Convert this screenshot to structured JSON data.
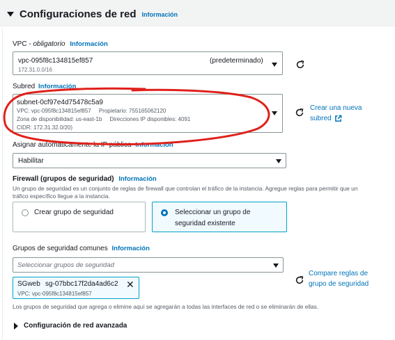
{
  "section": {
    "title": "Configuraciones de red",
    "info": "Información"
  },
  "vpc": {
    "label_main": "VPC - ",
    "label_req": "obligatorio",
    "info": "Información",
    "value": "vpc-095f8c134815ef857",
    "tag": "(predeterminado)",
    "cidr": "172.31.0.0/16"
  },
  "subnet": {
    "label": "Subred",
    "info": "Información",
    "value": "subnet-0cf97e4d75478c5a9",
    "line1": "VPC: vpc-095f8c134815ef857     Propietario: 755165062120",
    "line2": "Zona de disponibilidad: us-east-1b     Direcciones IP disponibles: 4091",
    "line3": "CIDR: 172.31.32.0/20)",
    "create_link_1": "Crear una nueva",
    "create_link_2": "subred"
  },
  "public_ip": {
    "label": "Asignar automáticamente la IP pública",
    "info": "Información",
    "value": "Habilitar"
  },
  "firewall": {
    "label": "Firewall (grupos de seguridad)",
    "info": "Información",
    "desc1": "Un grupo de seguridad es un conjunto de reglas de firewall que controlan el tráfico de la instancia. Agregue reglas para permitir que un",
    "desc2": "tráfico específico llegue a la instancia.",
    "option_create": "Crear grupo de seguridad",
    "option_select_1": "Seleccionar un grupo de",
    "option_select_2": "seguridad existente"
  },
  "common_groups": {
    "label": "Grupos de seguridad comunes",
    "info": "Información",
    "placeholder": "Seleccionar grupos de seguridad",
    "token_name": "SGweb",
    "token_id": "sg-07bbc17f2da4ad6c2",
    "token_vpc": "VPC: vpc-095f8c134815ef857",
    "compare_1": "Compare reglas de",
    "compare_2": "grupo de seguridad",
    "note": "Los grupos de seguridad que agrega o elimine aquí se agregarán a todas las interfaces de red o se eliminarán de ellas."
  },
  "advanced": {
    "label": "Configuración de red avanzada"
  },
  "colors": {
    "link": "#0073bb",
    "selected_border": "#00a1c9",
    "annotation": "#e0201b"
  }
}
